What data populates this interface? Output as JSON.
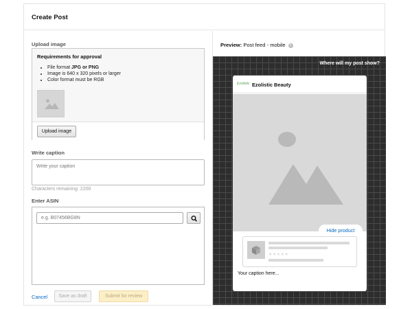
{
  "header": {
    "title": "Create Post"
  },
  "upload": {
    "section_label": "Upload image",
    "requirements_title": "Requirements for approval",
    "req1_prefix": "File format ",
    "req1_bold": "JPG or PNG",
    "req2": "Image is 640 x 320 pixels or larger",
    "req3": "Color format must be RGB",
    "button_label": "Upload image"
  },
  "caption": {
    "section_label": "Write caption",
    "placeholder": "Write your caption",
    "chars_remaining": "Characters remaining: 2200"
  },
  "asin": {
    "section_label": "Enter ASIN",
    "placeholder": "e.g. B07456BG8N"
  },
  "footer": {
    "cancel_label": "Cancel",
    "draft_label": "Save as draft",
    "submit_label": "Submit for review"
  },
  "preview": {
    "label_bold": "Preview:",
    "label_value": "Post feed - mobile",
    "info_glyph": "i",
    "where_link": "Where will my post show?",
    "brand_logo_text": "Ezolistic",
    "brand_name": "Ezolistic Beauty",
    "hide_product": "Hide product",
    "stars": "★★★★★",
    "caption_preview": "Your caption here..."
  },
  "colors": {
    "link": "#0066c0",
    "grid_background": "#2d2d2d",
    "submit_disabled": "#fcefc8",
    "placeholder_gray": "#d9d9d9"
  },
  "icons": {
    "image_placeholder": "image-placeholder-icon",
    "search": "search-icon",
    "info": "info-icon",
    "product": "product-box-icon"
  }
}
